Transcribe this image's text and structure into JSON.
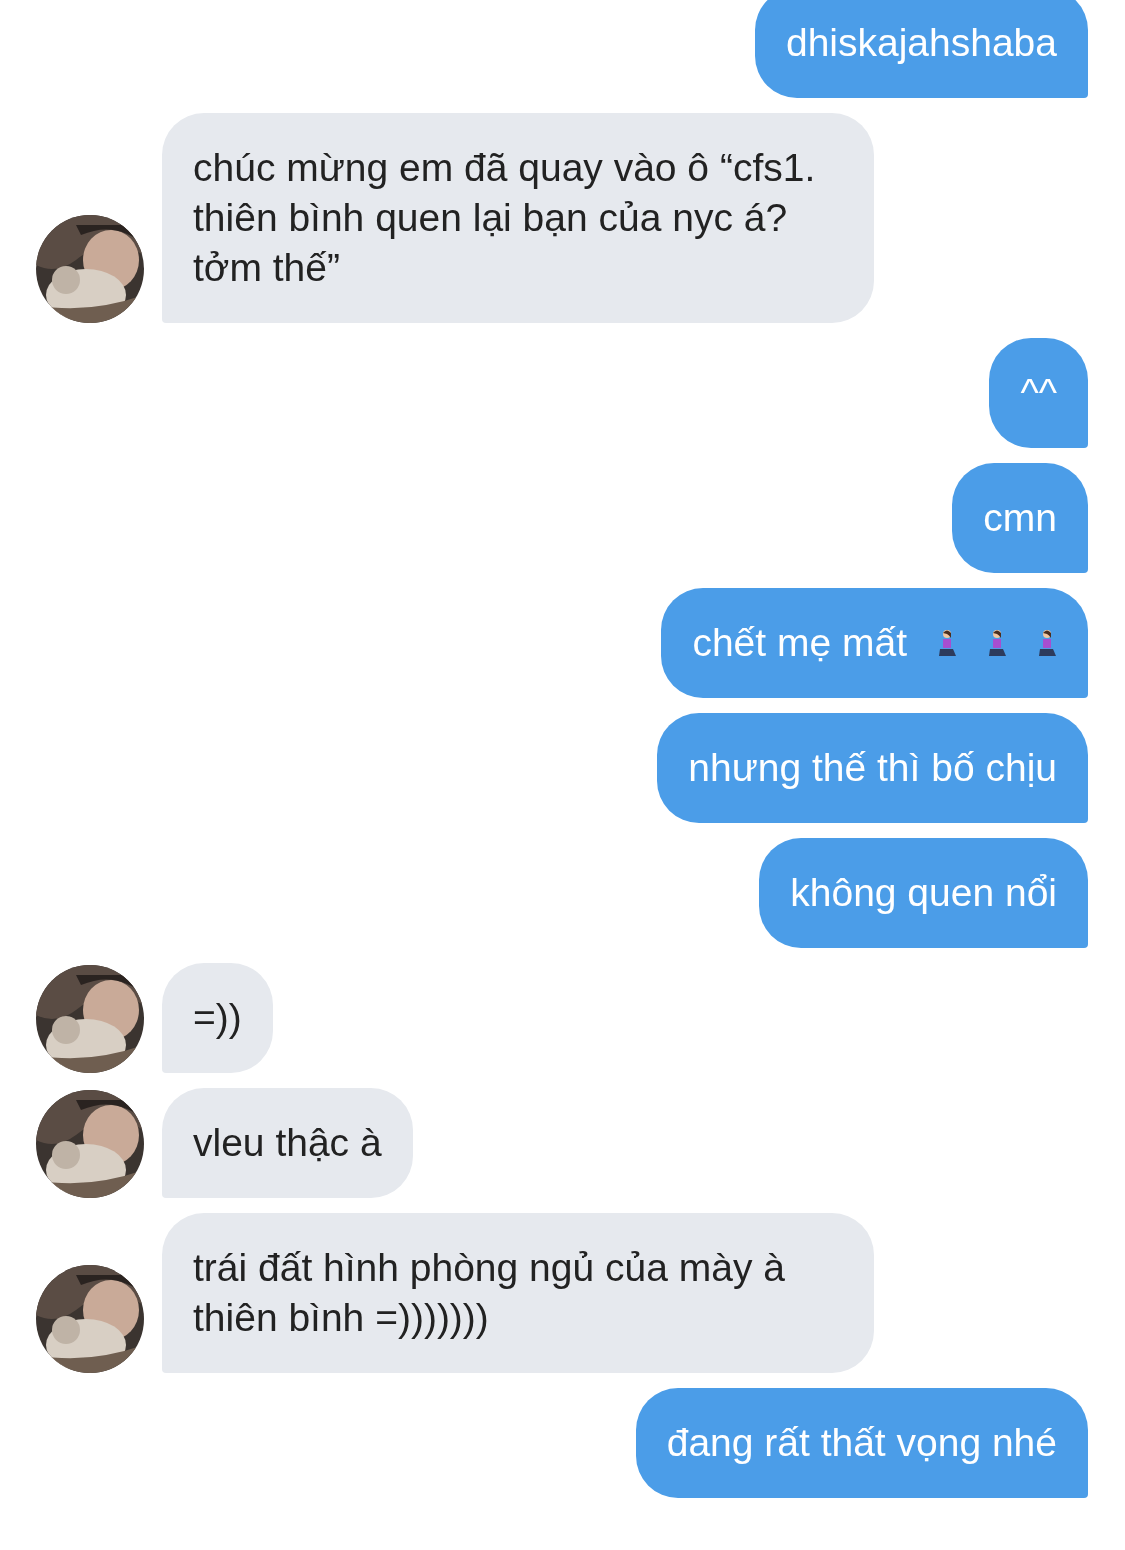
{
  "messages": [
    {
      "kind": "outgoing",
      "text": "dhiskajahshaba"
    },
    {
      "kind": "incoming",
      "text": "chúc mừng em đã quay vào ô “cfs1. thiên bình quen lại bạn của nyc á? tởm thế”"
    },
    {
      "kind": "outgoing",
      "text": "^^"
    },
    {
      "kind": "outgoing",
      "text": "cmn"
    },
    {
      "kind": "outgoing",
      "text": "chết mẹ mất",
      "trailing_icons": [
        {
          "kind": "kneeling-figure"
        },
        {
          "kind": "kneeling-figure"
        },
        {
          "kind": "kneeling-figure"
        }
      ]
    },
    {
      "kind": "outgoing",
      "text": "nhưng thế thì bố chịu"
    },
    {
      "kind": "outgoing",
      "text": "không quen nổi"
    },
    {
      "kind": "incoming",
      "text": "=))"
    },
    {
      "kind": "incoming",
      "text": "vleu thậc à"
    },
    {
      "kind": "incoming",
      "text": "trái đất hình phòng ngủ của mày à thiên bình =)))))))"
    },
    {
      "kind": "outgoing",
      "text": "đang rất thất vọng nhé"
    }
  ]
}
